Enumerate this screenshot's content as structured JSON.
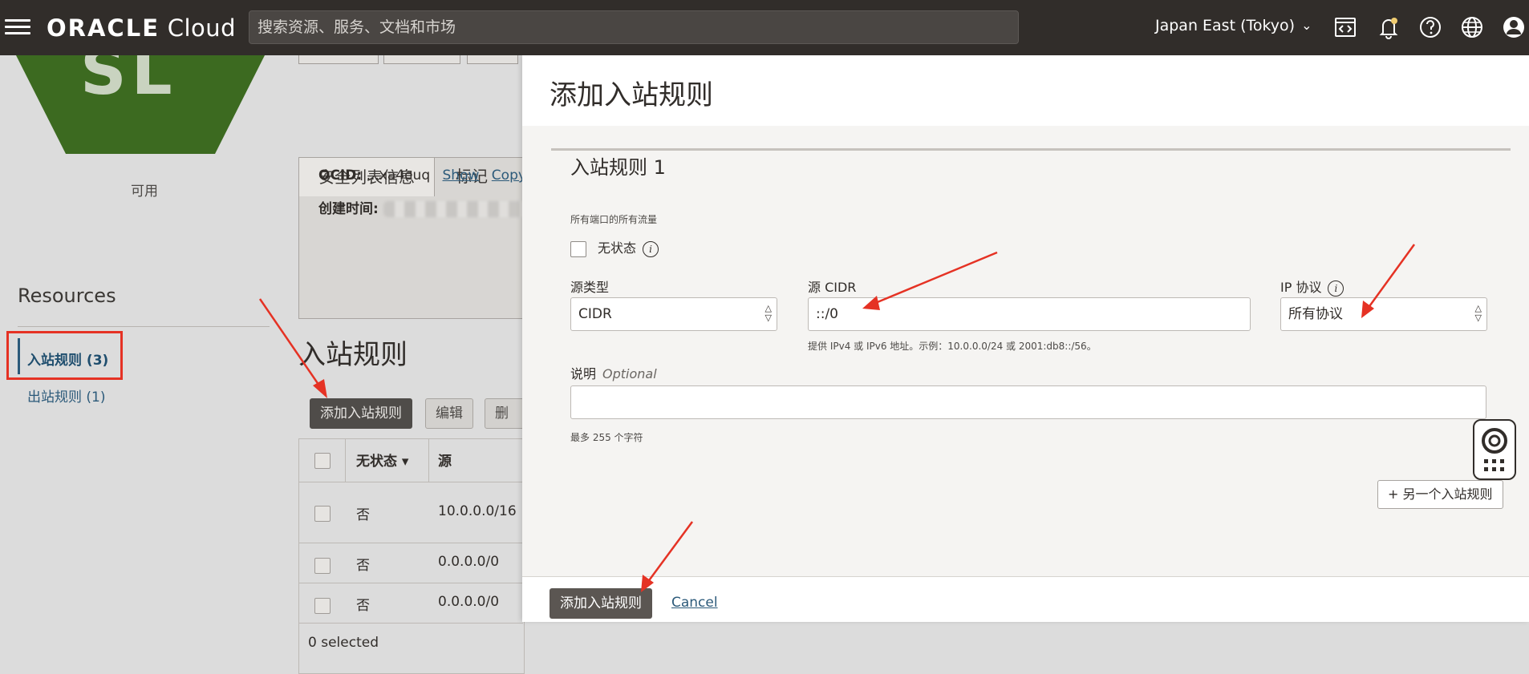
{
  "topbar": {
    "logo_brand": "ORACLE",
    "logo_product": "Cloud",
    "search_placeholder": "搜索资源、服务、文档和市场",
    "region": "Japan East (Tokyo)"
  },
  "background": {
    "hex_letters": "SL",
    "status": "可用",
    "resources_heading": "Resources",
    "resource_items": [
      {
        "label": "入站规则 (3)",
        "active": true
      },
      {
        "label": "出站规则 (1)",
        "active": false
      }
    ],
    "tabs": [
      "安全列表信息",
      "标记"
    ],
    "ocid_label": "OCID:",
    "ocid_value": "...xa4euq",
    "ocid_show": "Show",
    "ocid_copy": "Copy",
    "created_label": "创建时间:",
    "section_heading": "入站规则",
    "buttons": {
      "add": "添加入站规则",
      "edit": "编辑",
      "delete": "删除"
    },
    "table": {
      "headers": [
        "无状态",
        "源"
      ],
      "rows": [
        {
          "stateless": "否",
          "source": "10.0.0.0/16"
        },
        {
          "stateless": "否",
          "source": "0.0.0.0/0"
        },
        {
          "stateless": "否",
          "source": "0.0.0.0/0"
        }
      ],
      "footer": "0 selected"
    }
  },
  "drawer": {
    "title": "添加入站规则",
    "rule_heading": "入站规则 1",
    "note_all_traffic": "所有端口的所有流量",
    "stateless_label": "无状态",
    "source_type_label": "源类型",
    "source_type_value": "CIDR",
    "source_cidr_label": "源 CIDR",
    "source_cidr_value": "::/0",
    "source_cidr_hint": "提供 IPv4 或 IPv6 地址。示例：10.0.0.0/24 或 2001:db8::/56。",
    "ip_protocol_label": "IP 协议",
    "ip_protocol_value": "所有协议",
    "description_label": "说明",
    "description_optional": "Optional",
    "description_hint": "最多 255 个字符",
    "another_rule_button": "+ 另一个入站规则",
    "submit_button": "添加入站规则",
    "cancel_link": "Cancel"
  },
  "colors": {
    "topbar": "#312d2a",
    "accent_red": "#e53224",
    "link": "#2c5a7a",
    "hex_green": "#3c6a20"
  }
}
